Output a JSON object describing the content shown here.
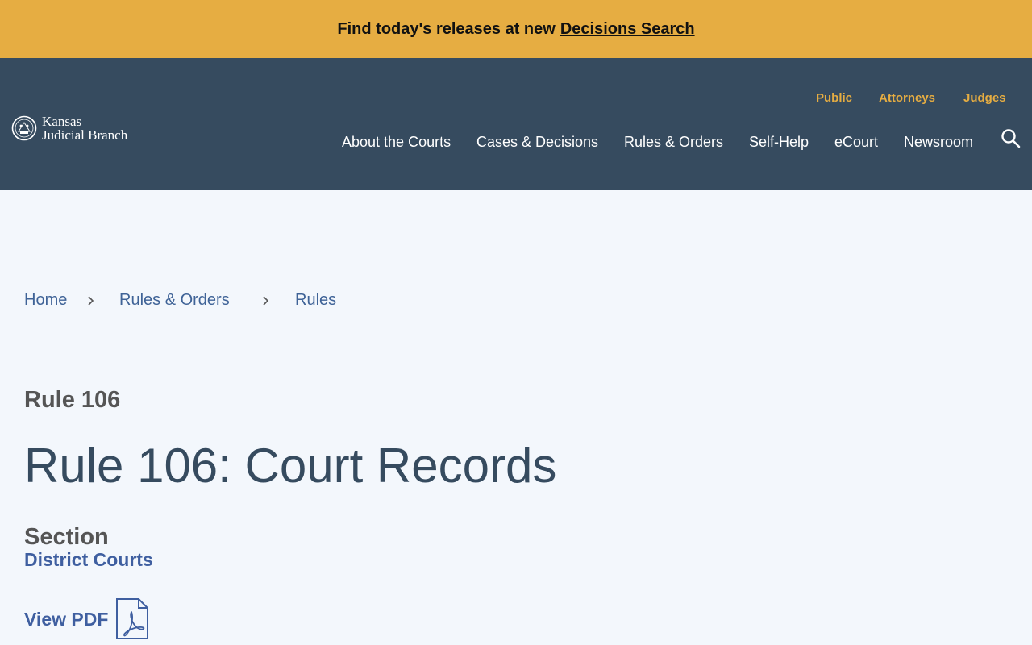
{
  "alert": {
    "text": "Find today's releases at new",
    "link_label": "Decisions Search"
  },
  "header": {
    "logo_line1": "Kansas",
    "logo_line2": "Judicial Branch",
    "audience_links": [
      "Public",
      "Attorneys",
      "Judges"
    ],
    "nav": [
      "About the Courts",
      "Cases & Decisions",
      "Rules & Orders",
      "Self-Help",
      "eCourt",
      "Newsroom"
    ],
    "accent_color": "#e6ad42",
    "header_color": "#364b5f"
  },
  "breadcrumb": [
    "Home",
    "Rules & Orders",
    "Rules"
  ],
  "content": {
    "eyebrow": "Rule 106",
    "title": "Rule 106: Court Records",
    "section_label": "Section",
    "section_value": "District Courts",
    "pdf_label": "View PDF"
  },
  "icons": {
    "search": "search-icon",
    "pdf": "pdf-icon",
    "seal": "kansas-seal-icon",
    "separator": "chevron-right-icon"
  }
}
